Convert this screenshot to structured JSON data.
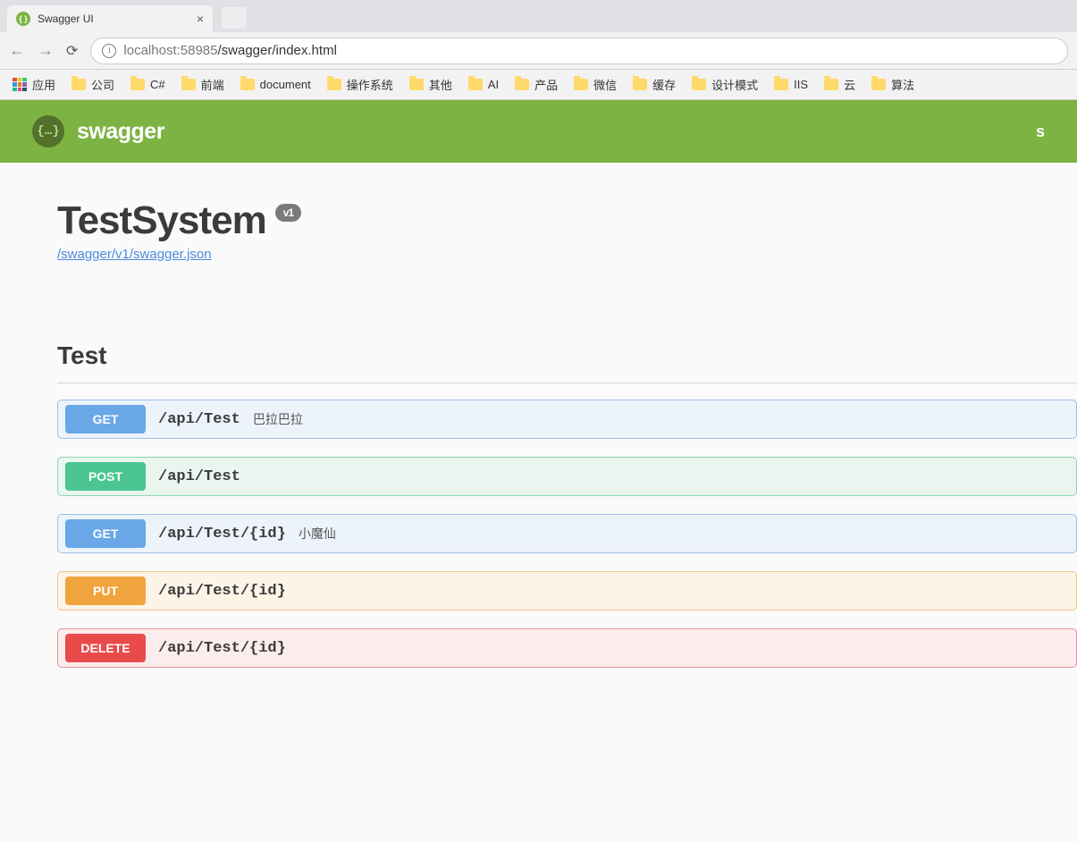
{
  "browser": {
    "tab_title": "Swagger UI",
    "url_host": "localhost:58985",
    "url_path": "/swagger/index.html"
  },
  "bookmarks": {
    "apps_label": "应用",
    "items": [
      "公司",
      "C#",
      "前端",
      "document",
      "操作系统",
      "其他",
      "AI",
      "产品",
      "微信",
      "缓存",
      "设计模式",
      "IIS",
      "云",
      "算法"
    ]
  },
  "swagger": {
    "brand": "swagger",
    "header_right": "s",
    "api_title": "TestSystem",
    "version": "v1",
    "json_link": "/swagger/v1/swagger.json",
    "tag": "Test",
    "operations": [
      {
        "method": "GET",
        "path": "/api/Test",
        "desc": "巴拉巴拉",
        "cls": "op-get"
      },
      {
        "method": "POST",
        "path": "/api/Test",
        "desc": "",
        "cls": "op-post"
      },
      {
        "method": "GET",
        "path": "/api/Test/{id}",
        "desc": "小魔仙",
        "cls": "op-get"
      },
      {
        "method": "PUT",
        "path": "/api/Test/{id}",
        "desc": "",
        "cls": "op-put"
      },
      {
        "method": "DELETE",
        "path": "/api/Test/{id}",
        "desc": "",
        "cls": "op-delete"
      }
    ]
  }
}
